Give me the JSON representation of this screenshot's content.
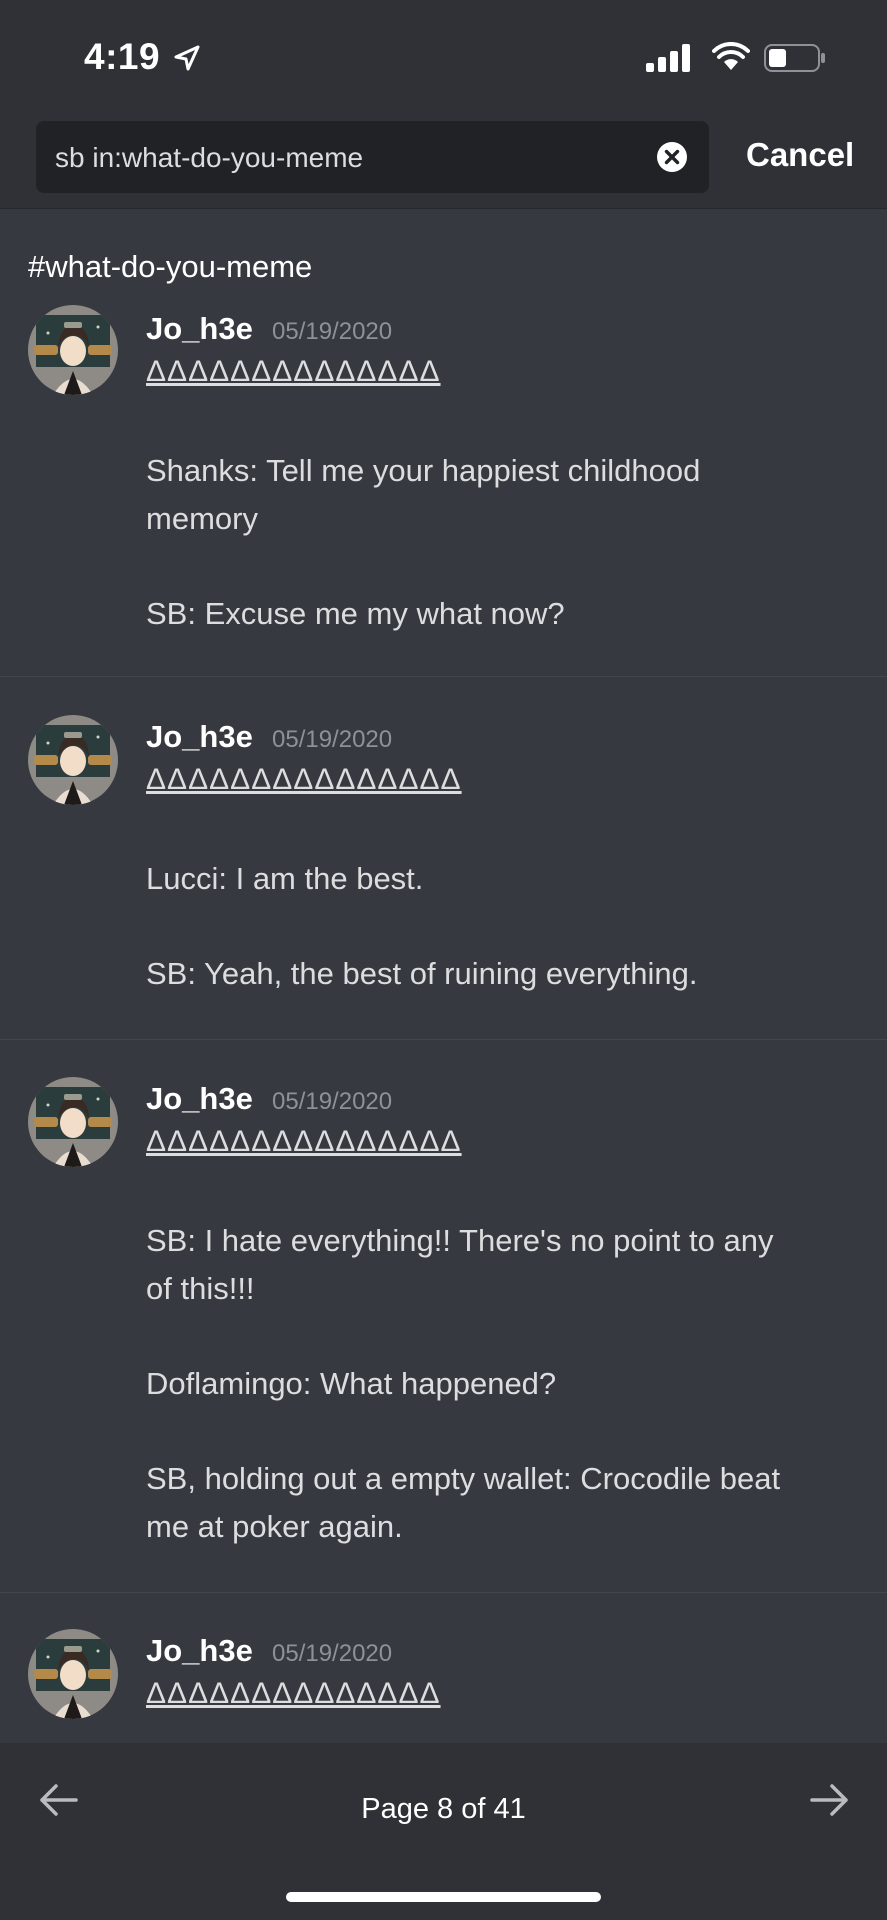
{
  "status_bar": {
    "time": "4:19"
  },
  "search": {
    "query": "sb in:what-do-you-meme",
    "cancel_label": "Cancel"
  },
  "channel": "#what-do-you-meme",
  "messages": [
    {
      "author": "Jo_h3e",
      "date": "05/19/2020",
      "tagline": "ΔΔΔΔΔΔΔΔΔΔΔΔΔΔ",
      "lines": [
        "Shanks: Tell me your happiest  childhood",
        "memory",
        "SB: Excuse me my what now?"
      ]
    },
    {
      "author": "Jo_h3e",
      "date": "05/19/2020",
      "tagline": "ΔΔΔΔΔΔΔΔΔΔΔΔΔΔΔ",
      "lines": [
        "Lucci: I am the best.",
        "SB: Yeah, the best of ruining everything."
      ]
    },
    {
      "author": "Jo_h3e",
      "date": "05/19/2020",
      "tagline": "ΔΔΔΔΔΔΔΔΔΔΔΔΔΔΔ",
      "lines": [
        "SB: I hate everything!! There's no point to any",
        "of this!!!",
        "Doflamingo: What happened?",
        "SB, holding out a empty wallet: Crocodile beat",
        "me at poker again."
      ]
    },
    {
      "author": "Jo_h3e",
      "date": "05/19/2020",
      "tagline": "ΔΔΔΔΔΔΔΔΔΔΔΔΔΔ",
      "lines": []
    }
  ],
  "pagination": {
    "label": "Page 8 of 41"
  },
  "colors": {
    "background": "#36393f",
    "header": "#2f3136",
    "search_box": "#202225",
    "timestamp": "#8e9297"
  }
}
